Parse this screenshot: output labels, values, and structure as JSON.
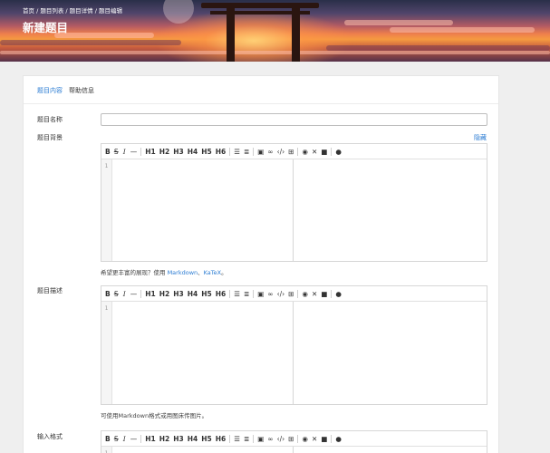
{
  "header": {
    "breadcrumbs": [
      "首页",
      "题目列表",
      "题目详情",
      "题目编辑"
    ],
    "separator": " / ",
    "title": "新建题目"
  },
  "tabs": [
    {
      "label": "题目内容",
      "active": true
    },
    {
      "label": "帮助信息",
      "active": false
    }
  ],
  "form": {
    "name_label": "题目名称",
    "name_value": "",
    "background_label": "题目背景",
    "hide_label": "隐藏",
    "background_hint_prefix": "希望更丰富的展现？使用 ",
    "background_hint_link1": "Markdown",
    "background_hint_sep": "、",
    "background_hint_link2": "KaTeX",
    "background_hint_suffix": "。",
    "description_label": "题目描述",
    "description_hint": "可使用Markdown格式或用图床传图片。",
    "input_format_label": "输入格式"
  },
  "editor": {
    "toolbar": [
      "B",
      "S",
      "I",
      "—",
      "|",
      "H1",
      "H2",
      "H3",
      "H4",
      "H5",
      "H6",
      "|",
      "ul",
      "ol",
      "|",
      "img",
      "link",
      "code",
      "table",
      "|",
      "preview",
      "fullscreen",
      "lock",
      "|",
      "info"
    ],
    "line_number": "1"
  },
  "colors": {
    "accent": "#2b7cd3",
    "background": "#efefef"
  }
}
